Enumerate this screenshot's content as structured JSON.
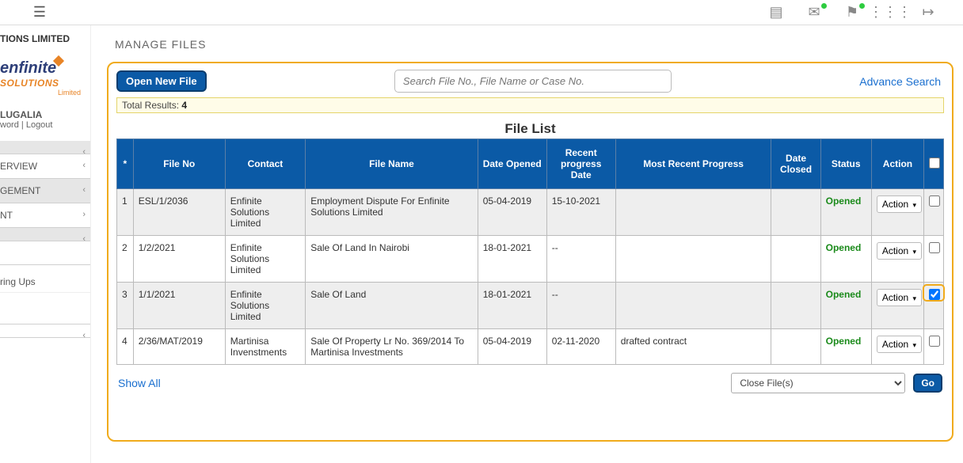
{
  "topbar": {},
  "sidebar": {
    "org_suffix": "TIONS LIMITED",
    "logo_line1a": "e",
    "logo_line1b": "nfinite",
    "logo_line2": "SOLUTIONS",
    "logo_line3": "Limited",
    "user_name": "LUGALIA",
    "user_line_word": "word",
    "user_line_logout": "Logout",
    "nav": {
      "overview": "ERVIEW",
      "management": "GEMENT",
      "nt": "NT",
      "bringups": "ring Ups"
    }
  },
  "page": {
    "title": "MANAGE FILES",
    "open_new": "Open New File",
    "search_placeholder": "Search File No., File Name or Case No.",
    "advance": "Advance Search",
    "results_prefix": "Total Results: ",
    "results_count": "4",
    "list_title": "File List",
    "show_all": "Show All",
    "bulk_option": "Close File(s)",
    "go": "Go"
  },
  "columns": {
    "star": "*",
    "file_no": "File No",
    "contact": "Contact",
    "file_name": "File Name",
    "date_opened": "Date Opened",
    "recent_progress_date": "Recent progress Date",
    "most_recent_progress": "Most Recent Progress",
    "date_closed": "Date Closed",
    "status": "Status",
    "action": "Action"
  },
  "rows": [
    {
      "idx": "1",
      "file_no": "ESL/1/2036",
      "contact": "Enfinite Solutions Limited",
      "file_name": "Employment Dispute For Enfinite Solutions Limited",
      "date_opened": "05-04-2019",
      "recent_date": "15-10-2021",
      "progress": "",
      "date_closed": "",
      "status": "Opened",
      "action": "Action",
      "checked": false
    },
    {
      "idx": "2",
      "file_no": "1/2/2021",
      "contact": "Enfinite Solutions Limited",
      "file_name": "Sale Of Land In Nairobi",
      "date_opened": "18-01-2021",
      "recent_date": "--",
      "progress": "",
      "date_closed": "",
      "status": "Opened",
      "action": "Action",
      "checked": false
    },
    {
      "idx": "3",
      "file_no": "1/1/2021",
      "contact": "Enfinite Solutions Limited",
      "file_name": "Sale Of Land",
      "date_opened": "18-01-2021",
      "recent_date": "--",
      "progress": "",
      "date_closed": "",
      "status": "Opened",
      "action": "Action",
      "checked": true
    },
    {
      "idx": "4",
      "file_no": "2/36/MAT/2019",
      "contact": "Martinisa Invenstments",
      "file_name": "Sale Of Property Lr No. 369/2014 To Martinisa Investments",
      "date_opened": "05-04-2019",
      "recent_date": "02-11-2020",
      "progress": "drafted contract",
      "date_closed": "",
      "status": "Opened",
      "action": "Action",
      "checked": false
    }
  ]
}
